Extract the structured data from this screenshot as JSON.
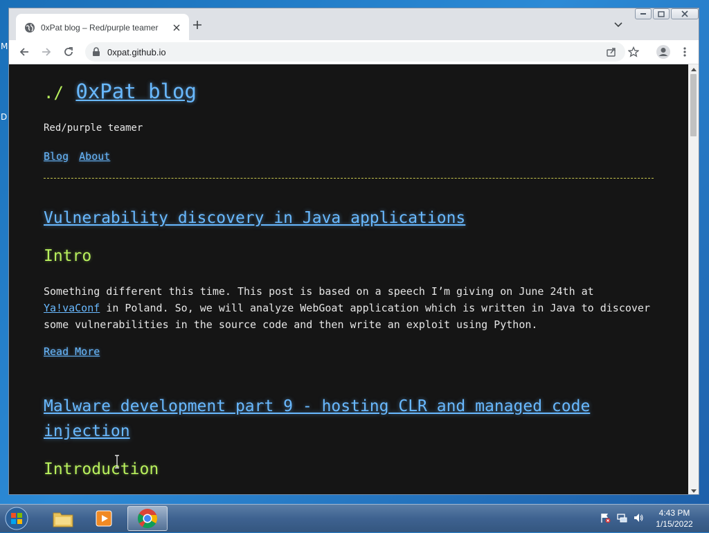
{
  "desktop": {
    "glyph1": "M",
    "glyph2": "D"
  },
  "tab": {
    "title": "0xPat blog – Red/purple teamer"
  },
  "toolbar": {
    "url": "0xpat.github.io"
  },
  "site": {
    "prompt": "./",
    "title": "0xPat blog",
    "tagline": "Red/purple teamer",
    "nav": [
      {
        "label": "Blog"
      },
      {
        "label": "About"
      }
    ]
  },
  "posts": [
    {
      "title": "Vulnerability discovery in Java applications",
      "heading": "Intro",
      "body_before_link": "Something different this time. This post is based on a speech I’m giving on June 24th at ",
      "link_text": "Ya!vaConf",
      "body_after_link": " in Poland. So, we will analyze WebGoat application which is written in Java to discover some vulnerabilities in the source code and then write an exploit using Python.",
      "read_more": "Read More"
    },
    {
      "title": "Malware development part 9 - hosting CLR and managed code injection",
      "heading": "Introduction"
    }
  ],
  "taskbar": {
    "clock_time": "4:43 PM",
    "clock_date": "1/15/2022"
  },
  "colors": {
    "page_bg": "#151515",
    "link": "#69b9ff",
    "heading": "#b8f05d",
    "divider": "#c8c64d"
  }
}
